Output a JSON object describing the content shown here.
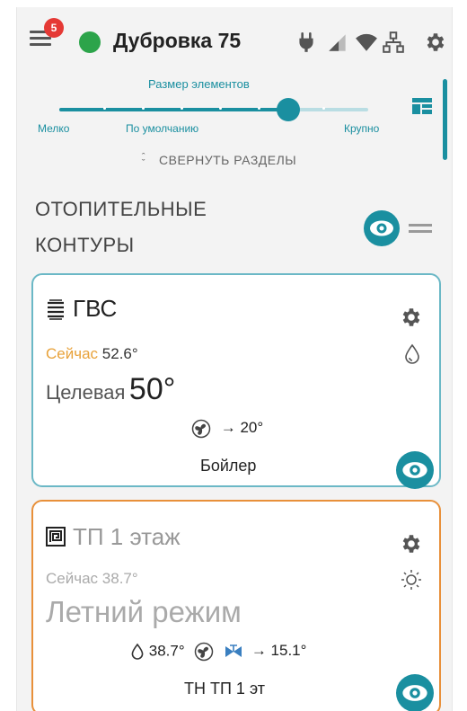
{
  "header": {
    "notification_count": "5",
    "title": "Дубровка 75",
    "status_color": "#2ca44a",
    "icons": [
      "menu-icon",
      "power-plug-icon",
      "cellular-signal-icon",
      "wifi-icon",
      "network-icon",
      "gear-icon"
    ]
  },
  "size_slider": {
    "label": "Размер элементов",
    "marks": [
      "Мелко",
      "По умолчанию",
      "Крупно"
    ],
    "value": 0.74,
    "layout_icon": "dashboard-layout-icon"
  },
  "collapse_label": "СВЕРНУТЬ РАЗДЕЛЫ",
  "section": {
    "title": "ОТОПИТЕЛЬНЫЕ КОНТУРЫ",
    "icons": [
      "eye-icon",
      "drag-handle-icon"
    ]
  },
  "cards": [
    {
      "name": "ГВС",
      "icon": "stacked-layers-icon",
      "now_label": "Сейчас",
      "now_value": "52.6°",
      "target_label": "Целевая",
      "target_value": "50°",
      "pump_target": "→ 20°",
      "device": "Бойлер",
      "mode_icon": "water-drop-icon",
      "accent": "#e8a23a",
      "border_color": "#6bb8c6"
    },
    {
      "name": "ТП 1 этаж",
      "icon": "floor-heating-icon",
      "now_label": "Сейчас",
      "now_value": "38.7°",
      "mode": "Летний режим",
      "drop_value": "38.7°",
      "flow_target": "→ 15.1°",
      "device": "ТН ТП 1 эт",
      "mode_icon": "sun-icon",
      "border_color": "#e8903a"
    }
  ],
  "colors": {
    "accent": "#1a8fa0",
    "online": "#2ca44a",
    "badge": "#e53935",
    "summer": "#e8903a"
  }
}
